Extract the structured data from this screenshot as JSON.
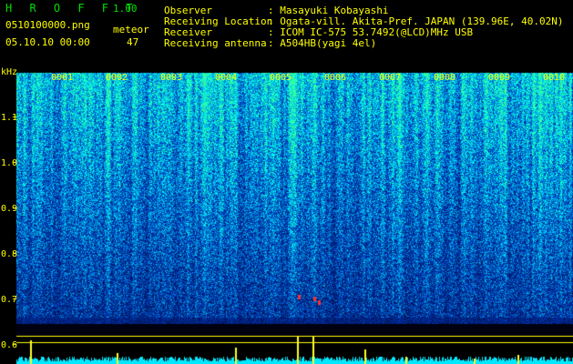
{
  "app": {
    "title": "H R O F F T",
    "version": "1.00"
  },
  "file": {
    "name": "0510100000.png",
    "datetime": "05.10.10 00:00"
  },
  "meteor": {
    "label": "meteor",
    "count": "47"
  },
  "info": [
    {
      "label": "Observer",
      "value": ": Masayuki Kobayashi"
    },
    {
      "label": "Receiving Location",
      "value": ": Ogata-vill. Akita-Pref. JAPAN (139.96E, 40.02N)"
    },
    {
      "label": "Receiver",
      "value": ": ICOM IC-575 53.7492(@LCD)MHz USB"
    },
    {
      "label": "Receiving antenna",
      "value": ": A504HB(yagi 4el)"
    }
  ],
  "axis": {
    "unit": "kHz",
    "ticks": [
      "1.1",
      "1.0",
      "0.9",
      "0.8",
      "0.7",
      "0.6"
    ]
  },
  "minutes": [
    "0001",
    "0002",
    "0003",
    "0004",
    "0005",
    "0006",
    "0007",
    "0008",
    "0009",
    "0010"
  ],
  "colors": {
    "background": "#000000",
    "text": "#ffff00",
    "title": "#00e000",
    "spectrum_low": "#00187a",
    "spectrum_high": "#30ffd0"
  }
}
